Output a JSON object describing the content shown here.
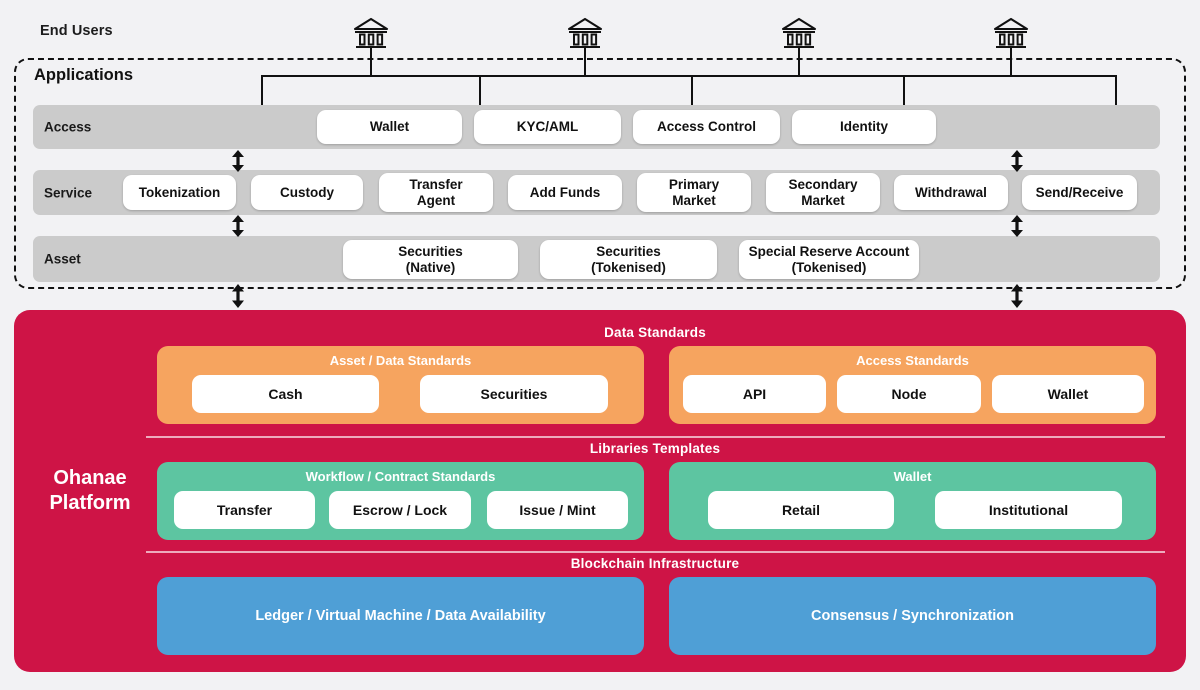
{
  "diagram": {
    "end_users_label": "End Users",
    "applications_title": "Applications",
    "platform_name_line1": "Ohanae",
    "platform_name_line2": "Platform",
    "end_user_icons": [
      {
        "name": "bank-icon-1"
      },
      {
        "name": "bank-icon-2"
      },
      {
        "name": "bank-icon-3"
      },
      {
        "name": "bank-icon-4"
      }
    ],
    "layers": [
      {
        "label": "Access",
        "items": [
          {
            "label": "Wallet"
          },
          {
            "label": "KYC/AML"
          },
          {
            "label": "Access Control"
          },
          {
            "label": "Identity"
          }
        ]
      },
      {
        "label": "Service",
        "items": [
          {
            "label": "Tokenization"
          },
          {
            "label": "Custody"
          },
          {
            "label": "Transfer\nAgent"
          },
          {
            "label": "Add Funds"
          },
          {
            "label": "Primary\nMarket"
          },
          {
            "label": "Secondary\nMarket"
          },
          {
            "label": "Withdrawal"
          },
          {
            "label": "Send/Receive"
          }
        ]
      },
      {
        "label": "Asset",
        "items": [
          {
            "label": "Securities\n(Native)"
          },
          {
            "label": "Securities\n(Tokenised)"
          },
          {
            "label": "Special Reserve Account\n(Tokenised)"
          }
        ]
      }
    ],
    "platform_sections": [
      {
        "title": "Data Standards",
        "groups": [
          {
            "title": "Asset / Data Standards",
            "color": "#f6a45f",
            "items": [
              {
                "label": "Cash"
              },
              {
                "label": "Securities"
              }
            ]
          },
          {
            "title": "Access Standards",
            "color": "#f6a45f",
            "items": [
              {
                "label": "API"
              },
              {
                "label": "Node"
              },
              {
                "label": "Wallet"
              }
            ]
          }
        ]
      },
      {
        "title": "Libraries Templates",
        "groups": [
          {
            "title": "Workflow / Contract Standards",
            "color": "#5dc5a1",
            "items": [
              {
                "label": "Transfer"
              },
              {
                "label": "Escrow / Lock"
              },
              {
                "label": "Issue / Mint"
              }
            ]
          },
          {
            "title": "Wallet",
            "color": "#5dc5a1",
            "items": [
              {
                "label": "Retail"
              },
              {
                "label": "Institutional"
              }
            ]
          }
        ]
      },
      {
        "title": "Blockchain Infrastructure",
        "groups": [
          {
            "title": "",
            "color": "#4f9fd6",
            "items": [
              {
                "label": "Ledger / Virtual Machine / Data Availability"
              }
            ]
          },
          {
            "title": "",
            "color": "#4f9fd6",
            "items": [
              {
                "label": "Consensus / Synchronization"
              }
            ]
          }
        ]
      }
    ],
    "colors": {
      "platform_pink": "#ce1446",
      "band_grey": "#cbcbcb",
      "orange": "#f6a45f",
      "green": "#5dc5a1",
      "blue": "#4f9fd6",
      "background": "#f2f2f4"
    }
  }
}
